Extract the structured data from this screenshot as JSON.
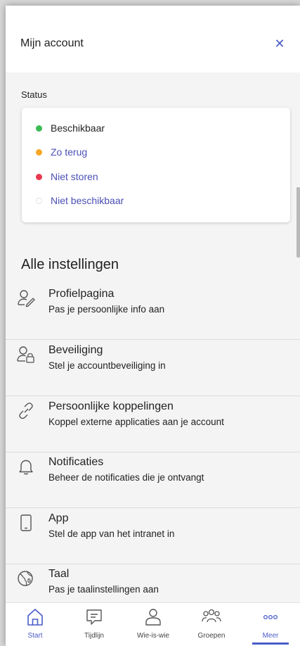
{
  "header": {
    "title": "Mijn account"
  },
  "status": {
    "label": "Status",
    "items": [
      {
        "label": "Beschikbaar",
        "color": "#3cba54",
        "selected": true
      },
      {
        "label": "Zo terug",
        "color": "#f5a623"
      },
      {
        "label": "Niet storen",
        "color": "#e8384f"
      },
      {
        "label": "Niet beschikbaar",
        "color": "#ececec"
      }
    ]
  },
  "settings": {
    "heading": "Alle instellingen",
    "items": [
      {
        "title": "Profielpagina",
        "subtitle": "Pas je persoonlijke info aan",
        "icon": "person-edit-icon"
      },
      {
        "title": "Beveiliging",
        "subtitle": "Stel je accountbeveiliging in",
        "icon": "person-lock-icon"
      },
      {
        "title": "Persoonlijke koppelingen",
        "subtitle": "Koppel externe applicaties aan je account",
        "icon": "link-icon"
      },
      {
        "title": "Notificaties",
        "subtitle": "Beheer de notificaties die je ontvangt",
        "icon": "bell-icon"
      },
      {
        "title": "App",
        "subtitle": "Stel de app van het intranet in",
        "icon": "phone-icon"
      },
      {
        "title": "Taal",
        "subtitle": "Pas je taalinstellingen aan",
        "icon": "globe-icon"
      }
    ]
  },
  "nav": {
    "items": [
      {
        "label": "Start",
        "icon": "home-icon",
        "active": true
      },
      {
        "label": "Tijdlijn",
        "icon": "chat-icon"
      },
      {
        "label": "Wie-is-wie",
        "icon": "person-icon"
      },
      {
        "label": "Groepen",
        "icon": "people-icon"
      },
      {
        "label": "Meer",
        "icon": "more-icon"
      }
    ]
  },
  "colors": {
    "accent": "#4a5cc7",
    "link": "#4a4fb5"
  }
}
